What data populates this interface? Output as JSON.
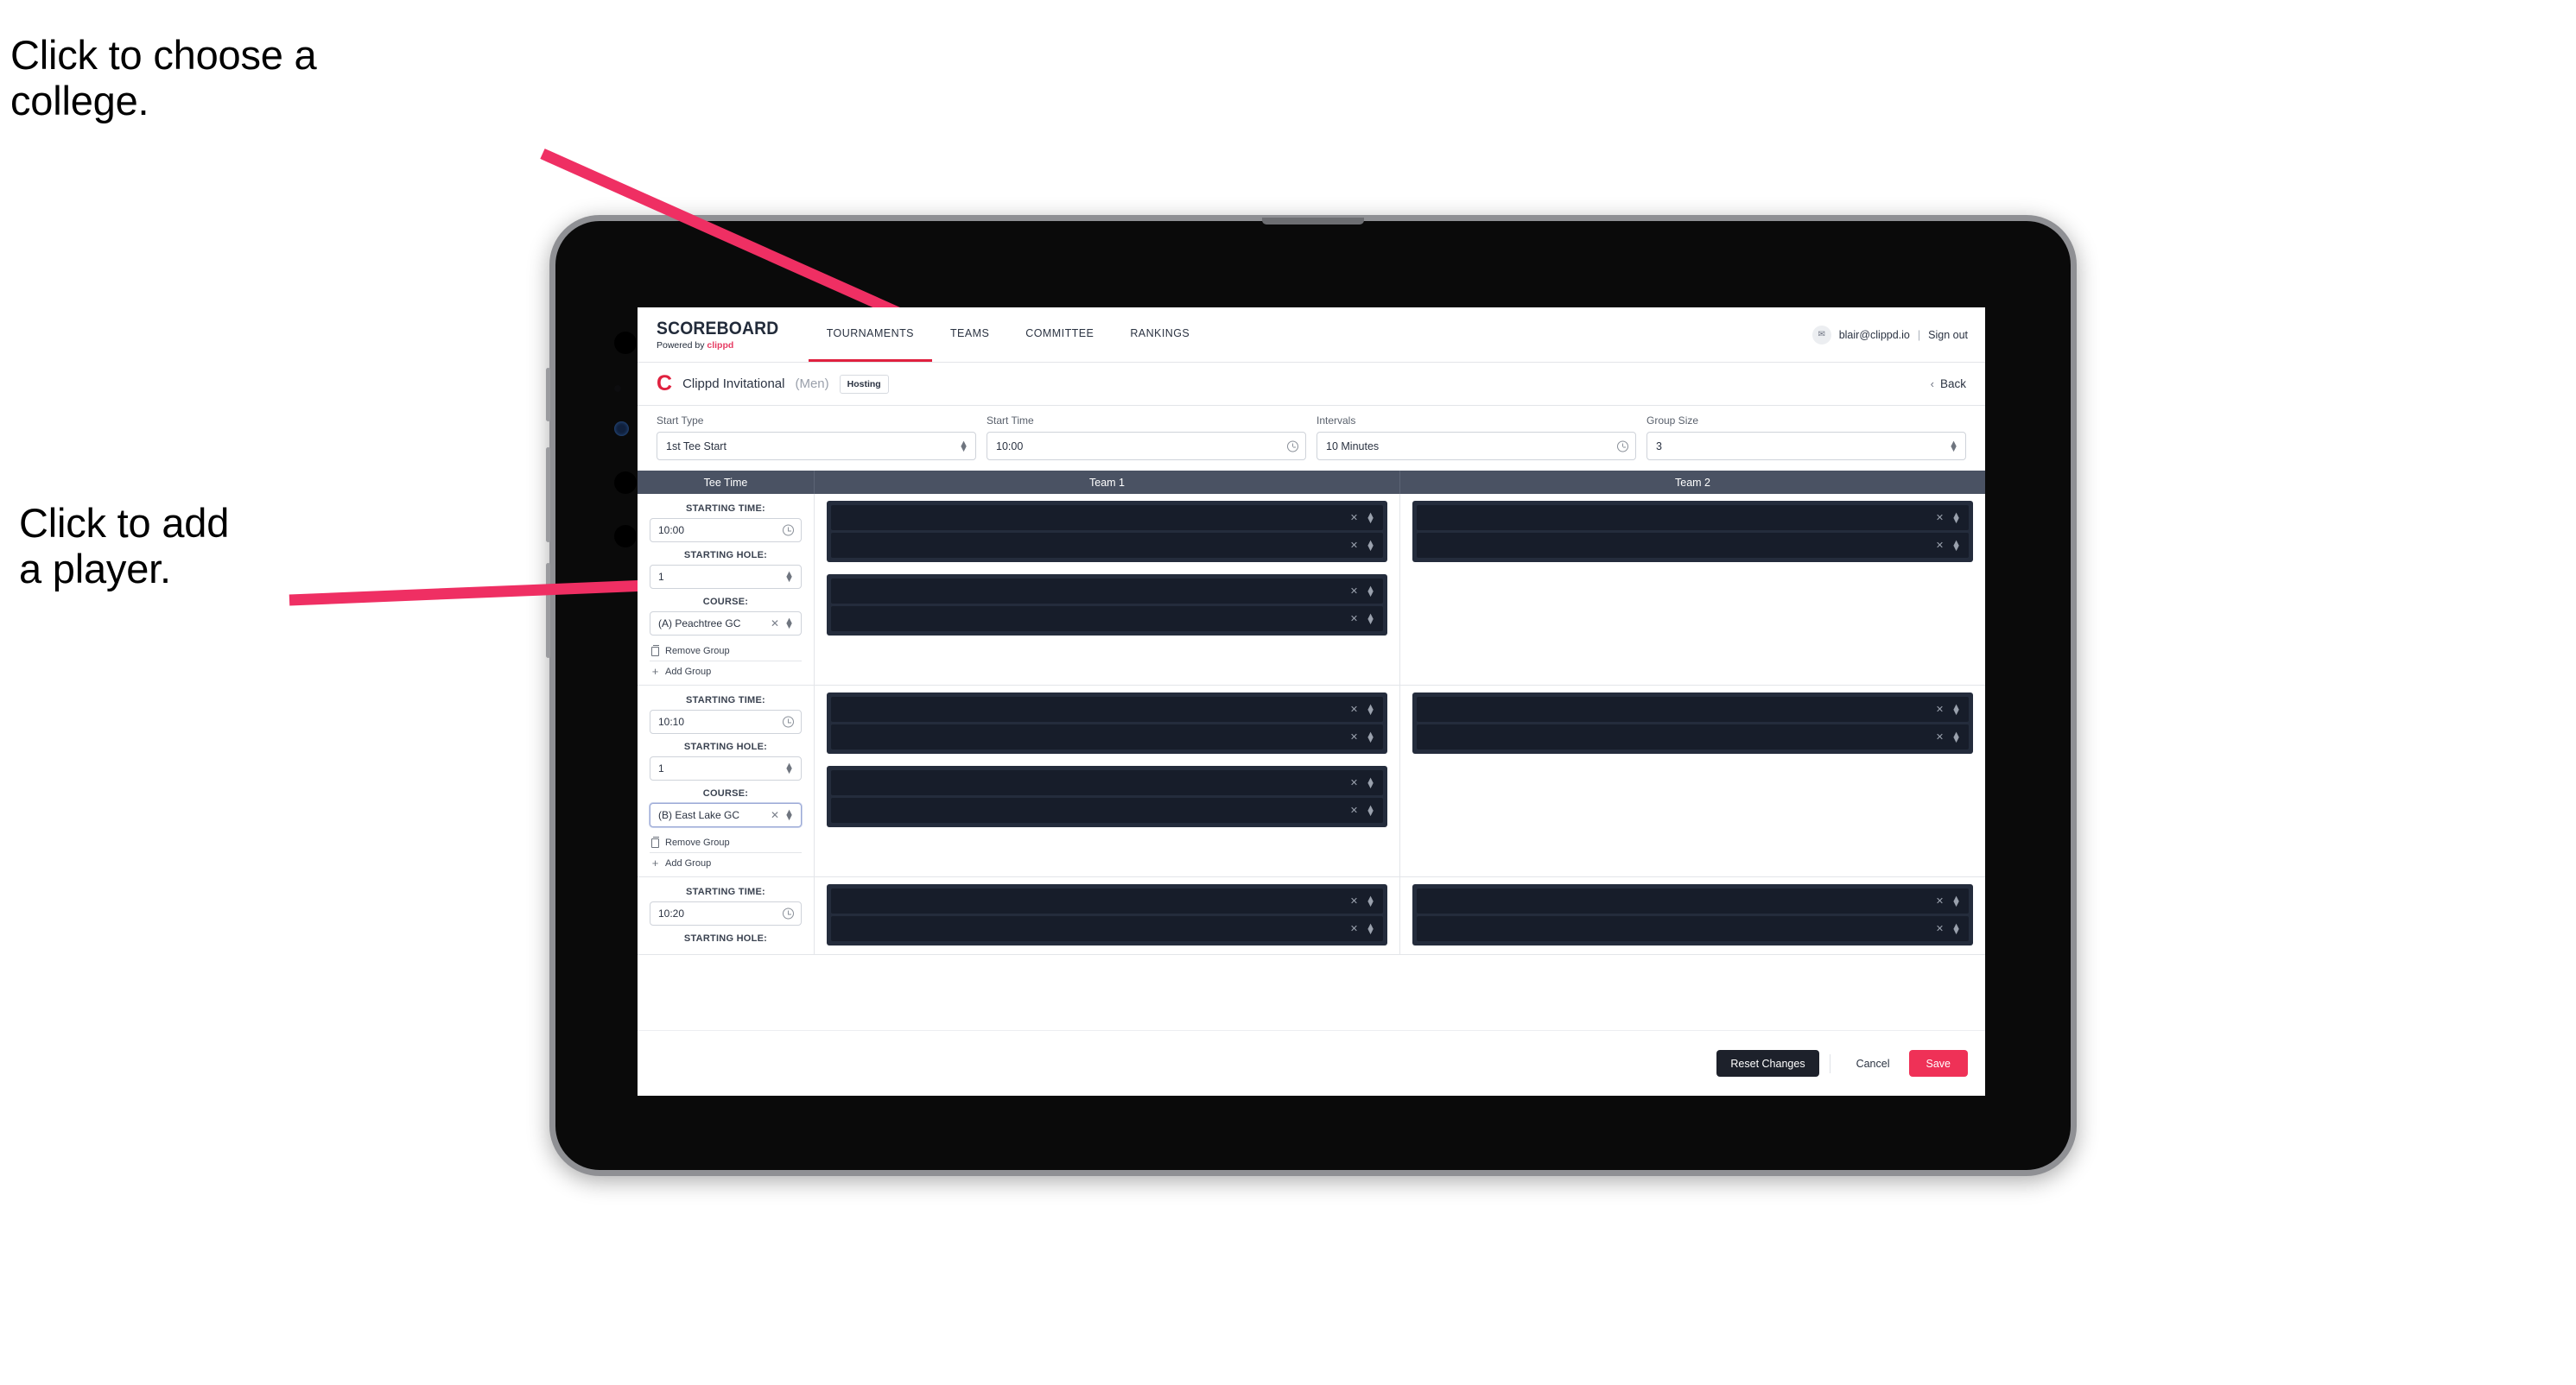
{
  "annotations": {
    "choose_college": "Click to choose a\ncollege.",
    "add_player": "Click to add\na player."
  },
  "colors": {
    "accent_pink": "#ef3157",
    "brand_red": "#e0213f",
    "table_header": "#4a5263",
    "card_dark": "#242c3c",
    "row_dark": "#171d2a",
    "arrow": "#ef2f63"
  },
  "app": {
    "brand": {
      "title": "SCOREBOARD",
      "powered_prefix": "Powered by ",
      "powered_brand": "clippd"
    },
    "nav_tabs": [
      {
        "label": "TOURNAMENTS",
        "active": true
      },
      {
        "label": "TEAMS",
        "active": false
      },
      {
        "label": "COMMITTEE",
        "active": false
      },
      {
        "label": "RANKINGS",
        "active": false
      }
    ],
    "account": {
      "avatar_glyph": "✉",
      "email": "blair@clippd.io",
      "separator": "|",
      "sign_out": "Sign out"
    },
    "tournament": {
      "logo_letter": "C",
      "name": "Clippd Invitational",
      "gender": "(Men)",
      "status_badge": "Hosting",
      "back_chevron": "‹",
      "back_label": "Back"
    },
    "filters": [
      {
        "label": "Start Type",
        "value": "1st Tee Start",
        "control": "stepper"
      },
      {
        "label": "Start Time",
        "value": "10:00",
        "control": "clock"
      },
      {
        "label": "Intervals",
        "value": "10 Minutes",
        "control": "clock"
      },
      {
        "label": "Group Size",
        "value": "3",
        "control": "stepper"
      }
    ],
    "table": {
      "headers": {
        "tee_time": "Tee Time",
        "team1": "Team 1",
        "team2": "Team 2"
      },
      "field_labels": {
        "starting_time": "STARTING TIME:",
        "starting_hole": "STARTING HOLE:",
        "course": "COURSE:"
      },
      "group_actions": {
        "remove": "Remove Group",
        "add": "Add Group"
      },
      "rows": [
        {
          "starting_time": "10:00",
          "starting_hole": "1",
          "course": "(A) Peachtree GC",
          "course_focused": false,
          "truncated": false,
          "team1_groups": [
            {
              "players": [
                "",
                ""
              ]
            },
            {
              "players": [
                "",
                ""
              ]
            }
          ],
          "team2_groups": [
            {
              "players": [
                "",
                ""
              ]
            }
          ]
        },
        {
          "starting_time": "10:10",
          "starting_hole": "1",
          "course": "(B) East Lake GC",
          "course_focused": true,
          "truncated": false,
          "team1_groups": [
            {
              "players": [
                "",
                ""
              ]
            },
            {
              "players": [
                "",
                ""
              ]
            }
          ],
          "team2_groups": [
            {
              "players": [
                "",
                ""
              ]
            }
          ]
        },
        {
          "starting_time": "10:20",
          "starting_hole": "",
          "course": "",
          "course_focused": false,
          "truncated": true,
          "team1_groups": [
            {
              "players": [
                "",
                ""
              ]
            }
          ],
          "team2_groups": [
            {
              "players": [
                "",
                ""
              ]
            }
          ]
        }
      ]
    },
    "footer": {
      "reset": "Reset Changes",
      "cancel": "Cancel",
      "save": "Save"
    }
  }
}
